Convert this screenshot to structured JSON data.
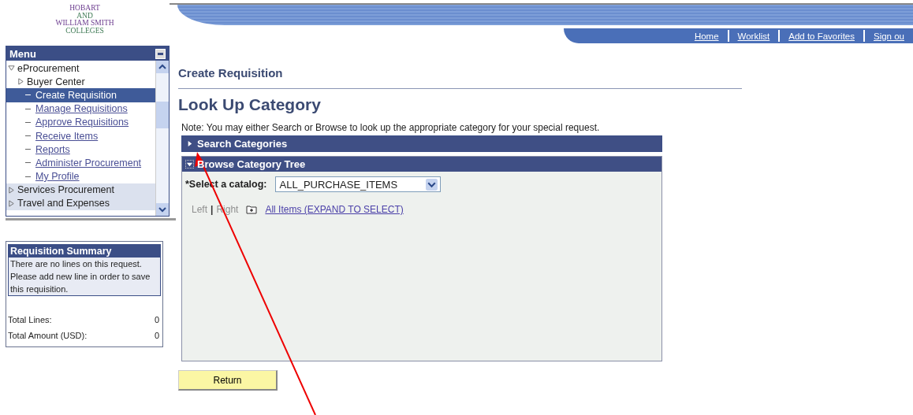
{
  "logo": {
    "lines": [
      "HOBART",
      "AND",
      "WILLIAM SMITH",
      "COLLEGES"
    ]
  },
  "header_links": [
    {
      "label": "Home"
    },
    {
      "label": "Worklist"
    },
    {
      "label": "Add to Favorites"
    },
    {
      "label": "Sign ou"
    }
  ],
  "menu": {
    "title": "Menu",
    "items": [
      {
        "label": "eProcurement",
        "kind": "folder",
        "expanded": true,
        "selected": false,
        "children": [
          {
            "label": "Buyer Center",
            "kind": "folder",
            "expanded": false,
            "selected": false
          },
          {
            "label": "Create Requisition",
            "kind": "link",
            "selected": true
          },
          {
            "label": "Manage Requisitions",
            "kind": "link",
            "selected": false
          },
          {
            "label": "Approve Requisitions",
            "kind": "link",
            "selected": false
          },
          {
            "label": "Receive Items",
            "kind": "link",
            "selected": false
          },
          {
            "label": "Reports",
            "kind": "link",
            "selected": false
          },
          {
            "label": "Administer Procurement",
            "kind": "link",
            "selected": false
          },
          {
            "label": "My Profile",
            "kind": "link",
            "selected": false
          }
        ]
      },
      {
        "label": "Services Procurement",
        "kind": "folder",
        "expanded": false,
        "selected": false
      },
      {
        "label": "Travel and Expenses",
        "kind": "folder",
        "expanded": false,
        "selected": false
      }
    ]
  },
  "summary": {
    "title": "Requisition Summary",
    "message": [
      "There are no lines on this request.",
      "Please add new line in order to save this requisition."
    ],
    "totals": [
      {
        "label": "Total Lines:",
        "value": "0"
      },
      {
        "label": "Total Amount (USD):",
        "value": "0"
      }
    ]
  },
  "breadcrumb": "Create Requisition",
  "page_title": "Look Up Category",
  "note": "Note: You may either Search or Browse to look up the appropriate category for your special request.",
  "sections": [
    {
      "title": "Search Categories",
      "expanded": false
    },
    {
      "title": "Browse Category Tree",
      "expanded": true
    }
  ],
  "catalog": {
    "label": "Select a catalog:",
    "required_mark": "*",
    "value": "ALL_PURCHASE_ITEMS"
  },
  "tree_nav": {
    "left": "Left",
    "separator": "|",
    "right": "Right",
    "root": "All Items (EXPAND TO SELECT)"
  },
  "buttons": [
    {
      "label": "Return"
    }
  ]
}
